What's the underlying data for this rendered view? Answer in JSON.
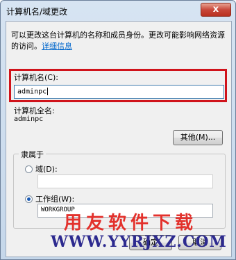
{
  "window": {
    "title": "计算机名/域更改",
    "close_glyph": "x"
  },
  "description": {
    "text": "可以更改这台计算机的名称和成员身份。更改可能影响网络资源的访问。",
    "link": "详细信息"
  },
  "computer_name": {
    "label": "计算机名(C):",
    "value": "adminpc"
  },
  "full_name": {
    "label": "计算机全名:",
    "value": "adminpc"
  },
  "buttons": {
    "other": "其他(M)...",
    "ok": "确定",
    "cancel": "取消"
  },
  "member_of": {
    "title": "隶属于",
    "domain": {
      "label": "域(D):",
      "value": "",
      "selected": false
    },
    "workgroup": {
      "label": "工作组(W):",
      "value": "WORKGROUP",
      "selected": true
    }
  },
  "watermark": {
    "line1": "用友软件下载",
    "line2": "WWW.YYRJXZ.COM"
  },
  "colors": {
    "highlight": "#d0131b",
    "link": "#0066cc",
    "watermark_red": "#e3312c",
    "watermark_blue": "#2d2a8f"
  }
}
